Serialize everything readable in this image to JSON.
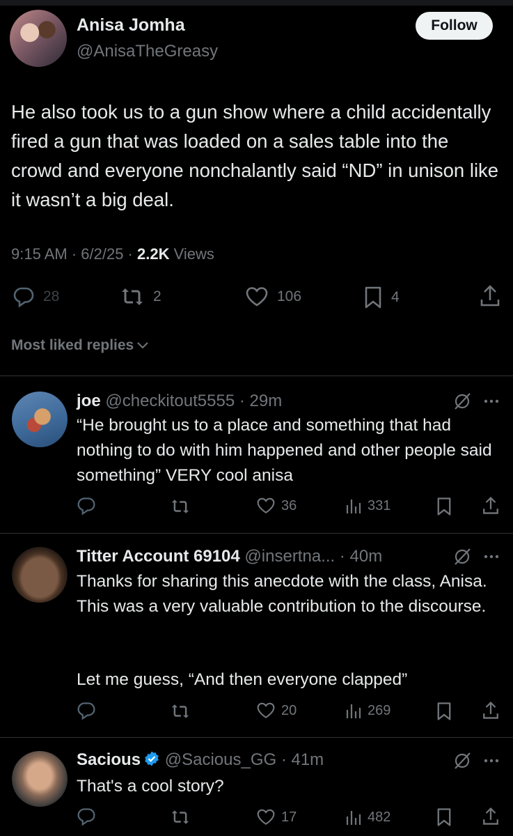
{
  "tweet": {
    "name": "Anisa Jomha",
    "handle": "@AnisaTheGreasy",
    "follow_label": "Follow",
    "text": "He also took us to a gun show where a child accidentally fired a gun that was loaded on a sales table into the crowd and everyone nonchalantly said “ND” in unison like it wasn’t a big deal.",
    "time": "9:15 AM · 6/2/25 · ",
    "views_count": "2.2K",
    "views_label": " Views",
    "stats": {
      "replies": "28",
      "reposts": "2",
      "likes": "106",
      "bookmarks": "4"
    }
  },
  "replies_sort_label": "Most liked replies",
  "replies": [
    {
      "name": "joe",
      "handle": "@checkitout5555 · 29m",
      "text": "“He brought us to a place and something that had nothing to do with him happened and other people said something” VERY cool anisa",
      "likes": "36",
      "views": "331"
    },
    {
      "name": "Titter Account 69104",
      "handle": "@insertna... · 40m",
      "text": "Thanks for sharing this anecdote with the class, Anisa. This was a very valuable contribution to the discourse.",
      "text2": "Let me guess, “And then everyone clapped”",
      "likes": "20",
      "views": "269"
    },
    {
      "name": "Sacious",
      "handle": "@Sacious_GG · 41m",
      "text": "That's a cool story?",
      "likes": "17",
      "views": "482"
    }
  ],
  "icons": [
    "reply-icon",
    "repost-icon",
    "like-icon",
    "bookmark-icon",
    "share-icon",
    "views-icon",
    "grok-icon",
    "more-icon",
    "verified-icon",
    "chevron-down-icon"
  ],
  "colors": {
    "background": "#000000",
    "text": "#e7e9ea",
    "secondary": "#71767b",
    "divider": "#2f3336",
    "verified": "#1d9bf0"
  }
}
